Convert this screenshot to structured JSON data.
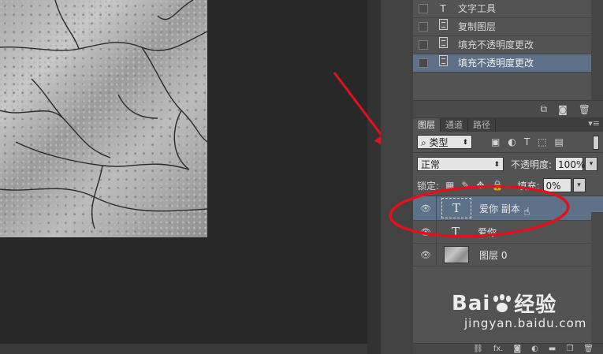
{
  "history": {
    "items": [
      {
        "label": "文字工具",
        "icon": "text-tool-icon",
        "active": false
      },
      {
        "label": "复制图层",
        "icon": "document-icon",
        "active": false
      },
      {
        "label": "填充不透明度更改",
        "icon": "document-icon",
        "active": false
      },
      {
        "label": "填充不透明度更改",
        "icon": "document-icon",
        "active": true
      }
    ]
  },
  "layers_panel": {
    "tabs": [
      "图层",
      "通道",
      "路径"
    ],
    "filter_kind": "类型",
    "blend_mode": "正常",
    "opacity_label": "不透明度:",
    "opacity_value": "100%",
    "lock_label": "锁定:",
    "fill_label": "填充:",
    "fill_value": "0%",
    "layers": [
      {
        "name": "爱你 副本",
        "type": "text",
        "selected": true,
        "visible": true
      },
      {
        "name": "爱你",
        "type": "text",
        "selected": false,
        "visible": true
      },
      {
        "name": "图层 0",
        "type": "image",
        "selected": false,
        "visible": true
      }
    ],
    "footer_icons": [
      "link-icon",
      "fx-icon",
      "mask-icon",
      "adjustment-icon",
      "group-folder-icon",
      "new-layer-icon",
      "trash-icon"
    ]
  },
  "annotations": {
    "highlight_color": "#e3111b"
  },
  "watermark": {
    "brand_left": "Bai",
    "brand_right": "经验",
    "url": "jingyan.baidu.com"
  }
}
